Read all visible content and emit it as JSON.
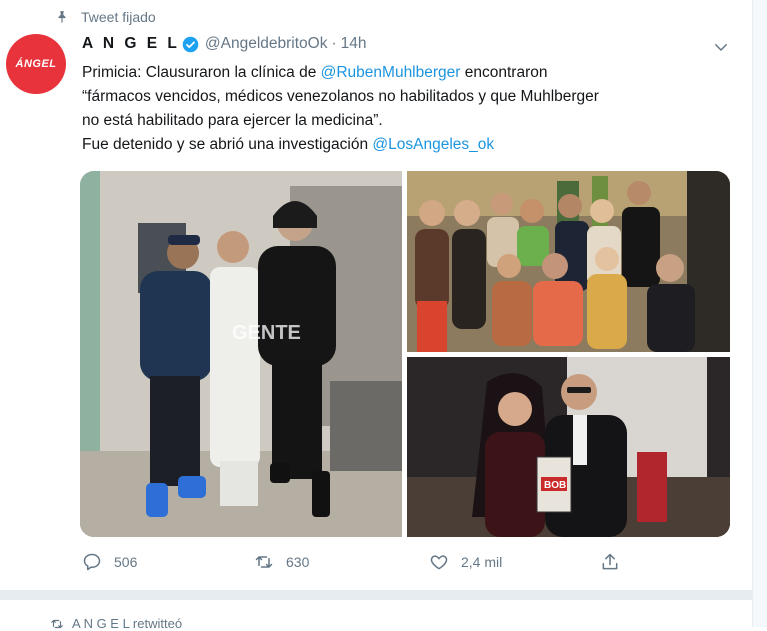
{
  "pinned": {
    "label": "Tweet fijado",
    "icon": "pin-icon"
  },
  "author": {
    "avatar_text": "ÁNGEL",
    "avatar_color": "#e8323c",
    "name": "A N G E L",
    "handle": "@AngeldebritoOk",
    "separator": "·",
    "time": "14h"
  },
  "tweet": {
    "line1_pre": "Primicia: Clausuraron la clínica de ",
    "mention1": "@RubenMuhlberger",
    "line1_post": " encontraron",
    "line2": "“fármacos vencidos, médicos venezolanos no habilitados y que Muhlberger",
    "line3": "no está habilitado para  ejercer la medicina”.",
    "line4_pre": "Fue detenido y se abrió una investigación ",
    "mention2": "@LosAngeles_ok"
  },
  "photos": {
    "p1_watermark": "GENTE",
    "p3_book_text": "BOB"
  },
  "actions": {
    "replies": "506",
    "retweets": "630",
    "likes": "2,4 mil"
  },
  "next_tweet": {
    "retweet_label": "A N G E L retwitteó"
  },
  "colors": {
    "link": "#1b95e0",
    "secondary": "#657786",
    "verified": "#1da1f2"
  }
}
